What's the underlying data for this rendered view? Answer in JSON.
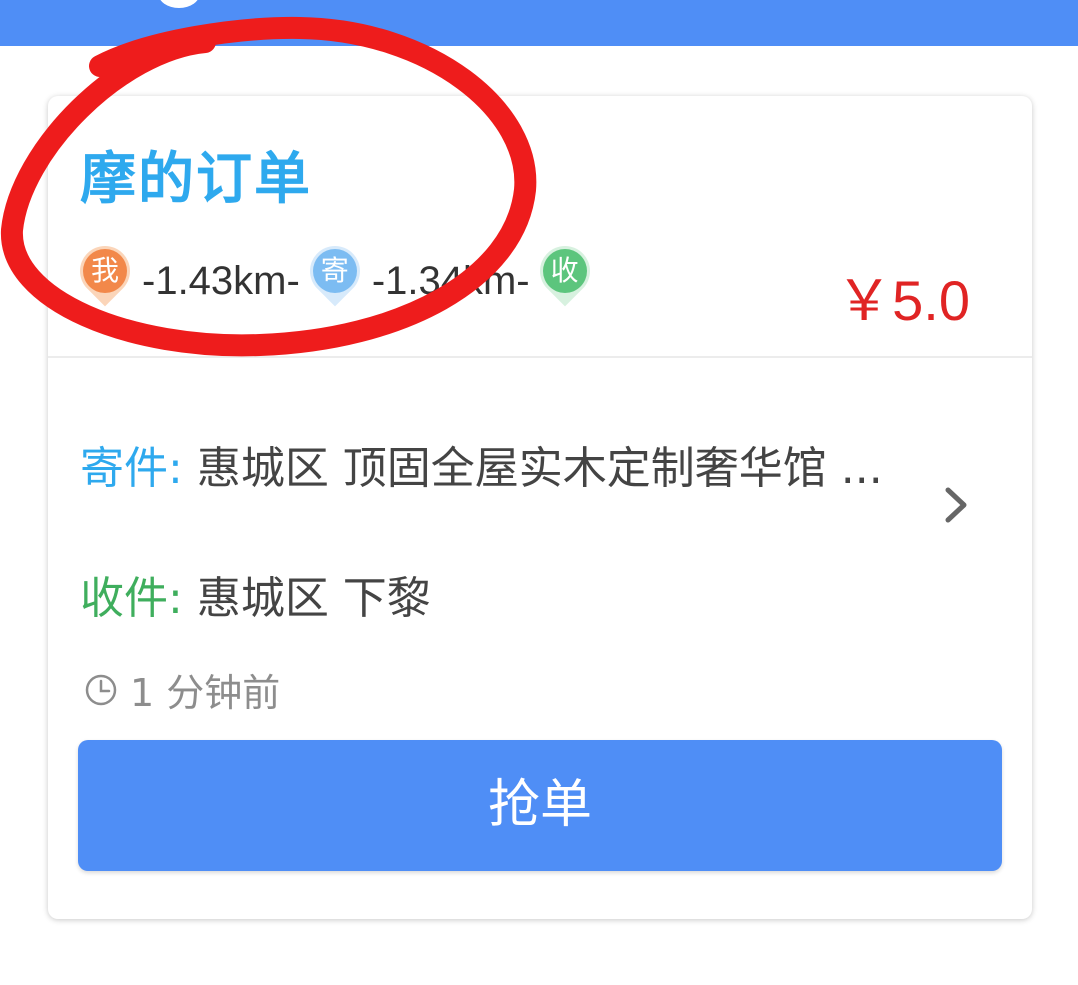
{
  "order": {
    "title": "摩的订单",
    "route": {
      "me_label": "我",
      "dist_to_sender": "-1.43km-",
      "send_label": "寄",
      "dist_to_receiver": "-1.34km-",
      "recv_label": "收"
    },
    "price": "￥5.0",
    "send": {
      "label": "寄件:",
      "address": " 惠城区 顶固全屋实木定制奢华馆 ..."
    },
    "recv": {
      "label": "收件:",
      "address": " 惠城区 下黎"
    },
    "time_ago": "1 分钟前",
    "grab_button": "抢单"
  },
  "colors": {
    "accent_blue": "#4f8ef6",
    "title_blue": "#2ea9ee",
    "price_red": "#e02424",
    "recv_green": "#3fae5d",
    "annotation_red": "#ee1c1c"
  },
  "icons": {
    "clock": "clock-icon",
    "chevron": "chevron-right-icon"
  }
}
